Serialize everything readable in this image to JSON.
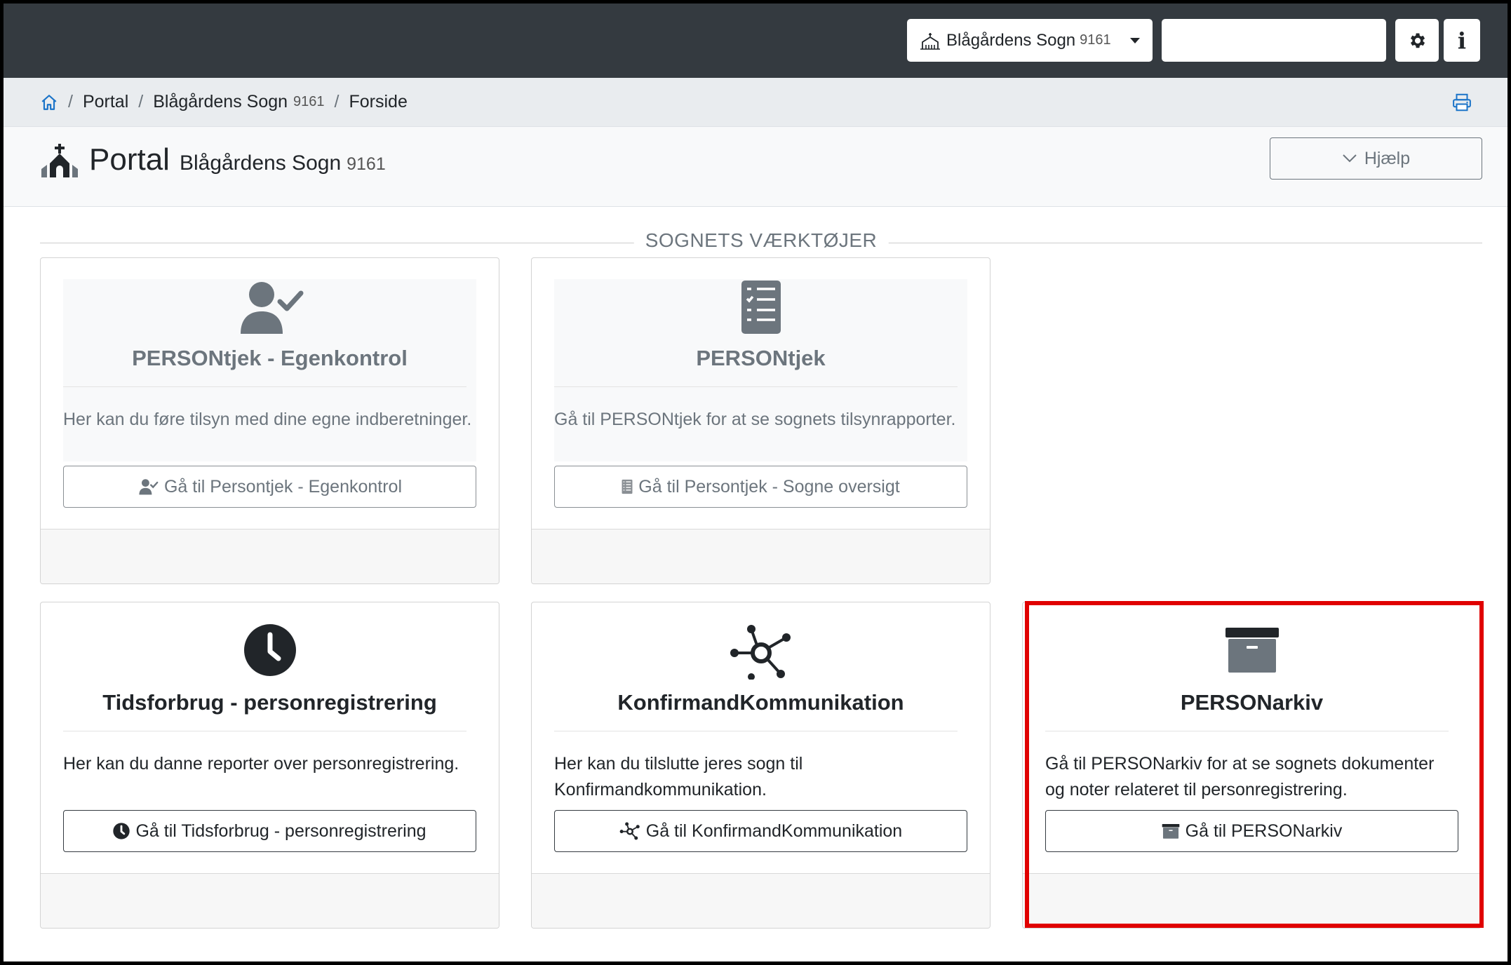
{
  "navbar": {
    "parish_name": "Blågårdens Sogn",
    "parish_number": "9161",
    "user_field_value": "",
    "settings_icon": "gear-icon",
    "info_icon": "info-icon",
    "info_label": "i"
  },
  "breadcrumb": {
    "home_icon": "home-icon",
    "separator": "/",
    "items": [
      {
        "label": "Portal"
      },
      {
        "label": "Blågårdens Sogn",
        "number": "9161"
      },
      {
        "label": "Forside"
      }
    ],
    "print_icon": "printer-icon"
  },
  "header": {
    "title": "Portal",
    "parish_name": "Blågårdens Sogn",
    "parish_number": "9161",
    "help_label": "Hjælp"
  },
  "section": {
    "heading": "SOGNETS VÆRKTØJER"
  },
  "cards": [
    {
      "icon": "user-check-icon",
      "title": "PERSONtjek - Egenkontrol",
      "description": "Her kan du føre tilsyn med dine egne indberetninger.",
      "button_label": "Gå til Persontjek - Egenkontrol",
      "disabled": true
    },
    {
      "icon": "checklist-icon",
      "title": "PERSONtjek",
      "description": "Gå til PERSONtjek for at se sognets tilsynrapporter.",
      "button_label": "Gå til Persontjek - Sogne oversigt",
      "disabled": true
    },
    {
      "icon": "clock-icon",
      "title": "Tidsforbrug - personregistrering",
      "description": "Her kan du danne reporter over personregistrering.",
      "button_label": "Gå til Tidsforbrug - personregistrering",
      "disabled": false
    },
    {
      "icon": "network-icon",
      "title": "KonfirmandKommunikation",
      "description": "Her kan du tilslutte jeres sogn til Konfirmandkommunikation.",
      "button_label": "Gå til KonfirmandKommunikation",
      "disabled": false
    },
    {
      "icon": "archive-icon",
      "title": "PERSONarkiv",
      "description": "Gå til PERSONarkiv for at se sognets dokumenter og noter relateret til personregistrering.",
      "button_label": "Gå til PERSONarkiv",
      "disabled": false,
      "highlighted": true
    }
  ],
  "colors": {
    "navbar": "#343a40",
    "highlight": "#e00000",
    "link": "#1a73c8"
  }
}
